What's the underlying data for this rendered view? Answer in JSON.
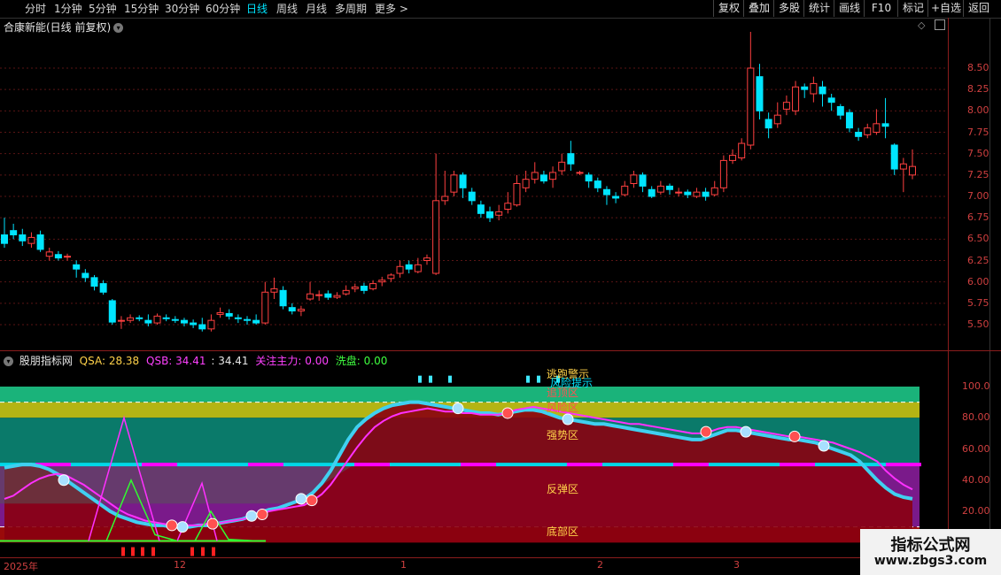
{
  "toolbar": {
    "timeframes": [
      "分时",
      "1分钟",
      "5分钟",
      "15分钟",
      "30分钟",
      "60分钟",
      "日线",
      "周线",
      "月线",
      "多周期",
      "更多"
    ],
    "active_timeframe": "日线",
    "right_buttons": [
      "复权",
      "叠加",
      "多股",
      "统计",
      "画线",
      "F10",
      "标记",
      "+自选",
      "返回"
    ]
  },
  "main_panel": {
    "title": "合康新能(日线 前复权)",
    "price_ticks": [
      "8.50",
      "8.25",
      "8.00",
      "7.75",
      "7.50",
      "7.25",
      "7.00",
      "6.75",
      "6.50",
      "6.25",
      "6.00",
      "5.75",
      "5.50"
    ],
    "colors": {
      "up": "#ff4040",
      "down": "#00e5ff",
      "grid": "#5a1515"
    }
  },
  "indicator_panel": {
    "title": "股朋指标网",
    "qsa_label": "QSA: 28.38",
    "qsb_label": "QSB: 34.41",
    "qsb_value_label": ": 34.41",
    "focus_label": "关注主力: 0.00",
    "wash_label": "洗盘: 0.00",
    "ticks": [
      "100.0",
      "80.00",
      "60.00",
      "40.00",
      "20.00"
    ],
    "zones": {
      "escape": "逃跑警示",
      "risk_tip": "风险提示",
      "chase": "追顶区",
      "risk": "风险区",
      "strong": "强势区",
      "rebound": "反弹区",
      "bottom": "底部区"
    }
  },
  "date_axis": {
    "labels": [
      "2025年",
      "12",
      "1",
      "2",
      "3"
    ]
  },
  "watermark": {
    "name": "指标公式网",
    "url": "www.zbgs3.com"
  },
  "chart_data": {
    "type": "candlestick",
    "title": "合康新能(日线 前复权)",
    "ylim": [
      5.4,
      8.75
    ],
    "candles": [
      [
        6.55,
        6.45,
        6.75,
        6.4
      ],
      [
        6.6,
        6.55,
        6.68,
        6.5
      ],
      [
        6.55,
        6.48,
        6.62,
        6.42
      ],
      [
        6.45,
        6.52,
        6.58,
        6.4
      ],
      [
        6.55,
        6.38,
        6.6,
        6.35
      ],
      [
        6.3,
        6.35,
        6.4,
        6.25
      ],
      [
        6.32,
        6.28,
        6.36,
        6.25
      ],
      [
        6.3,
        6.3,
        6.33,
        6.25
      ],
      [
        6.2,
        6.15,
        6.25,
        6.05
      ],
      [
        6.1,
        6.05,
        6.15,
        6.0
      ],
      [
        6.05,
        5.95,
        6.08,
        5.9
      ],
      [
        5.98,
        5.88,
        6.02,
        5.85
      ],
      [
        5.78,
        5.53,
        5.8,
        5.5
      ],
      [
        5.55,
        5.55,
        5.6,
        5.45
      ],
      [
        5.55,
        5.58,
        5.62,
        5.52
      ],
      [
        5.58,
        5.57,
        5.61,
        5.54
      ],
      [
        5.55,
        5.52,
        5.62,
        5.48
      ],
      [
        5.52,
        5.6,
        5.63,
        5.5
      ],
      [
        5.58,
        5.57,
        5.62,
        5.54
      ],
      [
        5.56,
        5.55,
        5.6,
        5.52
      ],
      [
        5.55,
        5.52,
        5.58,
        5.48
      ],
      [
        5.52,
        5.5,
        5.56,
        5.46
      ],
      [
        5.5,
        5.45,
        5.58,
        5.42
      ],
      [
        5.45,
        5.55,
        5.62,
        5.42
      ],
      [
        5.62,
        5.64,
        5.7,
        5.58
      ],
      [
        5.63,
        5.6,
        5.68,
        5.56
      ],
      [
        5.58,
        5.57,
        5.62,
        5.52
      ],
      [
        5.56,
        5.55,
        5.6,
        5.5
      ],
      [
        5.55,
        5.52,
        5.62,
        5.5
      ],
      [
        5.52,
        5.88,
        6.0,
        5.5
      ],
      [
        5.88,
        5.92,
        6.05,
        5.8
      ],
      [
        5.9,
        5.72,
        5.95,
        5.68
      ],
      [
        5.7,
        5.66,
        5.75,
        5.62
      ],
      [
        5.66,
        5.68,
        5.72,
        5.6
      ],
      [
        5.8,
        5.86,
        6.0,
        5.78
      ],
      [
        5.84,
        5.85,
        5.9,
        5.78
      ],
      [
        5.86,
        5.82,
        5.9,
        5.79
      ],
      [
        5.82,
        5.84,
        5.88,
        5.8
      ],
      [
        5.86,
        5.9,
        5.96,
        5.84
      ],
      [
        5.92,
        5.94,
        5.98,
        5.88
      ],
      [
        5.95,
        5.9,
        5.99,
        5.86
      ],
      [
        5.92,
        5.98,
        6.02,
        5.9
      ],
      [
        6.0,
        6.02,
        6.06,
        5.95
      ],
      [
        6.04,
        6.08,
        6.1,
        6.0
      ],
      [
        6.1,
        6.18,
        6.25,
        6.05
      ],
      [
        6.2,
        6.15,
        6.25,
        6.1
      ],
      [
        6.12,
        6.2,
        6.28,
        6.1
      ],
      [
        6.25,
        6.28,
        6.32,
        6.2
      ],
      [
        6.1,
        6.95,
        7.5,
        6.08
      ],
      [
        6.95,
        7.0,
        7.3,
        6.9
      ],
      [
        7.05,
        7.25,
        7.3,
        7.0
      ],
      [
        7.25,
        7.1,
        7.28,
        6.98
      ],
      [
        7.05,
        6.95,
        7.1,
        6.9
      ],
      [
        6.9,
        6.8,
        6.95,
        6.75
      ],
      [
        6.82,
        6.75,
        6.88,
        6.7
      ],
      [
        6.78,
        6.82,
        6.9,
        6.72
      ],
      [
        6.85,
        6.92,
        7.05,
        6.8
      ],
      [
        6.9,
        7.15,
        7.25,
        6.88
      ],
      [
        7.1,
        7.2,
        7.3,
        7.05
      ],
      [
        7.2,
        7.28,
        7.4,
        7.15
      ],
      [
        7.25,
        7.18,
        7.3,
        7.15
      ],
      [
        7.2,
        7.28,
        7.35,
        7.1
      ],
      [
        7.3,
        7.4,
        7.5,
        7.25
      ],
      [
        7.5,
        7.38,
        7.65,
        7.3
      ],
      [
        7.28,
        7.28,
        7.3,
        7.25
      ],
      [
        7.25,
        7.18,
        7.28,
        7.1
      ],
      [
        7.18,
        7.1,
        7.22,
        7.05
      ],
      [
        7.08,
        7.02,
        7.12,
        6.9
      ],
      [
        7.0,
        6.98,
        7.05,
        6.92
      ],
      [
        7.02,
        7.12,
        7.18,
        7.0
      ],
      [
        7.15,
        7.25,
        7.3,
        7.1
      ],
      [
        7.25,
        7.12,
        7.28,
        7.05
      ],
      [
        7.08,
        7.0,
        7.12,
        6.98
      ],
      [
        7.05,
        7.12,
        7.18,
        7.02
      ],
      [
        7.12,
        7.08,
        7.15,
        7.02
      ],
      [
        7.05,
        7.05,
        7.1,
        7.0
      ],
      [
        7.05,
        7.02,
        7.08,
        6.98
      ],
      [
        7.0,
        7.05,
        7.1,
        6.98
      ],
      [
        7.05,
        7.0,
        7.1,
        6.95
      ],
      [
        7.02,
        7.1,
        7.18,
        7.0
      ],
      [
        7.1,
        7.42,
        7.48,
        7.05
      ],
      [
        7.42,
        7.48,
        7.55,
        7.38
      ],
      [
        7.45,
        7.62,
        7.68,
        7.42
      ],
      [
        7.6,
        8.5,
        8.95,
        7.55
      ],
      [
        8.4,
        8.0,
        8.55,
        7.9
      ],
      [
        7.9,
        7.8,
        7.98,
        7.68
      ],
      [
        7.85,
        7.95,
        8.1,
        7.8
      ],
      [
        8.02,
        8.1,
        8.18,
        7.95
      ],
      [
        8.0,
        8.28,
        8.35,
        7.95
      ],
      [
        8.28,
        8.25,
        8.32,
        8.15
      ],
      [
        8.2,
        8.32,
        8.4,
        8.1
      ],
      [
        8.28,
        8.2,
        8.35,
        8.05
      ],
      [
        8.15,
        8.1,
        8.2,
        8.0
      ],
      [
        8.05,
        7.95,
        8.08,
        7.9
      ],
      [
        7.98,
        7.8,
        8.02,
        7.75
      ],
      [
        7.75,
        7.7,
        7.8,
        7.65
      ],
      [
        7.72,
        7.8,
        7.85,
        7.68
      ],
      [
        7.75,
        7.85,
        8.02,
        7.72
      ],
      [
        7.85,
        7.82,
        8.15,
        7.68
      ],
      [
        7.6,
        7.32,
        7.62,
        7.25
      ],
      [
        7.32,
        7.38,
        7.45,
        7.05
      ],
      [
        7.25,
        7.35,
        7.55,
        7.2
      ]
    ],
    "indicator": {
      "type": "line",
      "ylim": [
        0,
        110
      ],
      "series": [
        {
          "name": "QSA",
          "last": 28.38
        },
        {
          "name": "QSB",
          "last": 34.41
        },
        {
          "name": "关注主力",
          "last": 0.0
        },
        {
          "name": "洗盘",
          "last": 0.0
        }
      ],
      "qsa_values": [
        48,
        49,
        50,
        50,
        49,
        47,
        44,
        40,
        36,
        32,
        28,
        24,
        20,
        17,
        15,
        13,
        12,
        11,
        11,
        10,
        10,
        10,
        11,
        11,
        12,
        13,
        14,
        15,
        17,
        19,
        21,
        22,
        24,
        26,
        28,
        32,
        38,
        46,
        56,
        66,
        74,
        79,
        83,
        86,
        88,
        89,
        90,
        90,
        89,
        88,
        87,
        86,
        85,
        84,
        83,
        83,
        82,
        83,
        84,
        85,
        85,
        84,
        82,
        80,
        79,
        78,
        77,
        76,
        76,
        75,
        74,
        73,
        72,
        71,
        70,
        69,
        68,
        67,
        66,
        66,
        68,
        70,
        72,
        72,
        71,
        70,
        69,
        68,
        67,
        66,
        66,
        65,
        64,
        62,
        60,
        58,
        56,
        52,
        46,
        40,
        35,
        31,
        29,
        28
      ],
      "qsb_values": [
        28,
        30,
        34,
        38,
        41,
        43,
        44,
        43,
        40,
        37,
        33,
        29,
        25,
        21,
        18,
        16,
        14,
        13,
        12,
        11,
        11,
        11,
        11,
        12,
        12,
        13,
        14,
        15,
        16,
        18,
        20,
        21,
        22,
        23,
        24,
        27,
        31,
        37,
        45,
        53,
        61,
        68,
        74,
        78,
        81,
        83,
        84,
        85,
        86,
        85,
        84,
        84,
        83,
        83,
        82,
        82,
        82,
        83,
        85,
        86,
        87,
        86,
        85,
        84,
        83,
        82,
        81,
        80,
        79,
        78,
        77,
        76,
        76,
        75,
        74,
        73,
        72,
        71,
        70,
        70,
        71,
        73,
        74,
        74,
        73,
        72,
        71,
        70,
        69,
        68,
        68,
        67,
        66,
        65,
        64,
        62,
        60,
        58,
        55,
        52,
        46,
        41,
        37,
        34
      ]
    }
  }
}
